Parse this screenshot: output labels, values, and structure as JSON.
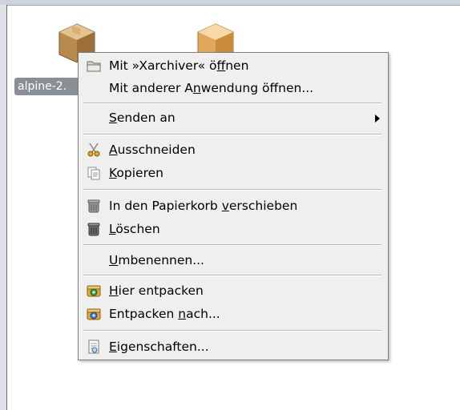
{
  "desktop": {
    "file1_label": "alpine-2."
  },
  "menu": {
    "open_with_xarchiver": [
      "Mit »Xarchiver« ö",
      "f",
      "fnen"
    ],
    "open_other": [
      "Mit anderer A",
      "n",
      "wendung öffnen..."
    ],
    "send_to": [
      "",
      "S",
      "enden an"
    ],
    "cut": [
      "",
      "A",
      "usschneiden"
    ],
    "copy": [
      "",
      "K",
      "opieren"
    ],
    "trash": [
      "In den Papierkorb ",
      "v",
      "erschieben"
    ],
    "delete": [
      "",
      "L",
      "öschen"
    ],
    "rename": [
      "",
      "U",
      "mbenennen..."
    ],
    "extract_here": [
      "",
      "H",
      "ier entpacken"
    ],
    "extract_to": [
      "Entpacken ",
      "n",
      "ach..."
    ],
    "properties": [
      "",
      "E",
      "igenschaften..."
    ]
  },
  "icons": {
    "open_with_xarchiver": "folder-icon",
    "cut": "scissors-icon",
    "copy": "copy-icon",
    "trash": "trash-icon",
    "delete": "delete-icon",
    "extract_here": "archive-extract-icon",
    "extract_to": "archive-extract-to-icon",
    "properties": "properties-icon",
    "submenu": "chevron-right-icon"
  }
}
